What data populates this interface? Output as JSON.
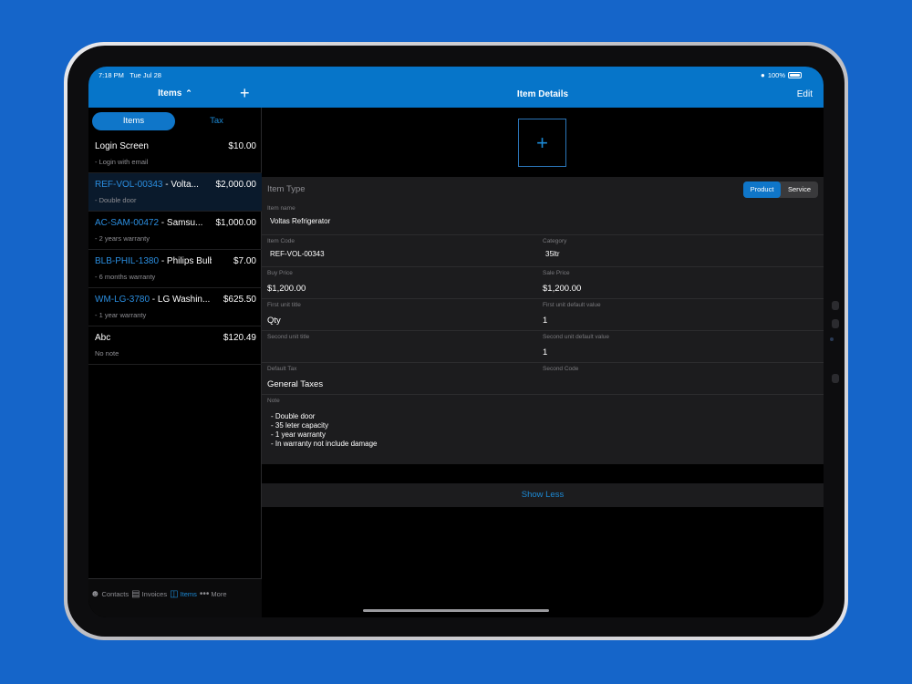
{
  "status": {
    "time": "7:18 PM",
    "date": "Tue Jul 28",
    "battery": "100%",
    "battery_level": 1.0
  },
  "nav": {
    "left_title": "Items",
    "center_title": "Item Details",
    "edit_label": "Edit",
    "add_icon": "+"
  },
  "segments": [
    {
      "label": "Items",
      "active": true
    },
    {
      "label": "Tax",
      "active": false
    }
  ],
  "list": [
    {
      "title": "Login Screen",
      "code": "",
      "name": "",
      "price": "$10.00",
      "sub": "- Login with email"
    },
    {
      "title": "",
      "code": "REF-VOL-00343",
      "name": " - Volta...",
      "price": "$2,000.00",
      "sub": "- Double door",
      "selected": true
    },
    {
      "title": "",
      "code": "AC-SAM-00472",
      "name": " - Samsu...",
      "price": "$1,000.00",
      "sub": "- 2 years warranty"
    },
    {
      "title": "",
      "code": "BLB-PHIL-1380",
      "name": " - Philips Bulb",
      "price": "$7.00",
      "sub": "- 6 months warranty"
    },
    {
      "title": "",
      "code": "WM-LG-3780",
      "name": " - LG Washin...",
      "price": "$625.50",
      "sub": "- 1 year warranty"
    },
    {
      "title": "Abc",
      "code": "",
      "name": "",
      "price": "$120.49",
      "sub": "No note"
    }
  ],
  "tabs": [
    {
      "label": "Contacts",
      "icon": "people-icon"
    },
    {
      "label": "Invoices",
      "icon": "document-icon"
    },
    {
      "label": "Items",
      "icon": "tray-icon",
      "active": true
    },
    {
      "label": "More",
      "icon": "ellipsis-icon"
    }
  ],
  "detail": {
    "image_add": "+",
    "item_type_label": "Item Type",
    "type_options": {
      "product": "Product",
      "service": "Service",
      "selected": "Product"
    },
    "item_name": {
      "label": "Item name",
      "value": "Voltas Refrigerator"
    },
    "item_code": {
      "label": "Item Code",
      "value": "REF-VOL-00343"
    },
    "category": {
      "label": "Category",
      "value": "35ltr"
    },
    "buy_price": {
      "label": "Buy Price",
      "value": "$1,200.00"
    },
    "sale_price": {
      "label": "Sale Price",
      "value": "$1,200.00"
    },
    "first_unit_title": {
      "label": "First unit title",
      "value": "Qty"
    },
    "first_unit_default": {
      "label": "First unit default value",
      "value": "1"
    },
    "second_unit_title": {
      "label": "Second unit title",
      "value": ""
    },
    "second_unit_default": {
      "label": "Second unit default value",
      "value": "1"
    },
    "default_tax": {
      "label": "Default Tax",
      "value": "General Taxes"
    },
    "second_code": {
      "label": "Second Code",
      "value": ""
    },
    "note": {
      "label": "Note",
      "lines": [
        "- Double door",
        "- 35 leter capacity",
        "- 1 year warranty",
        "- In warranty not include damage"
      ]
    },
    "show_less": "Show Less"
  }
}
